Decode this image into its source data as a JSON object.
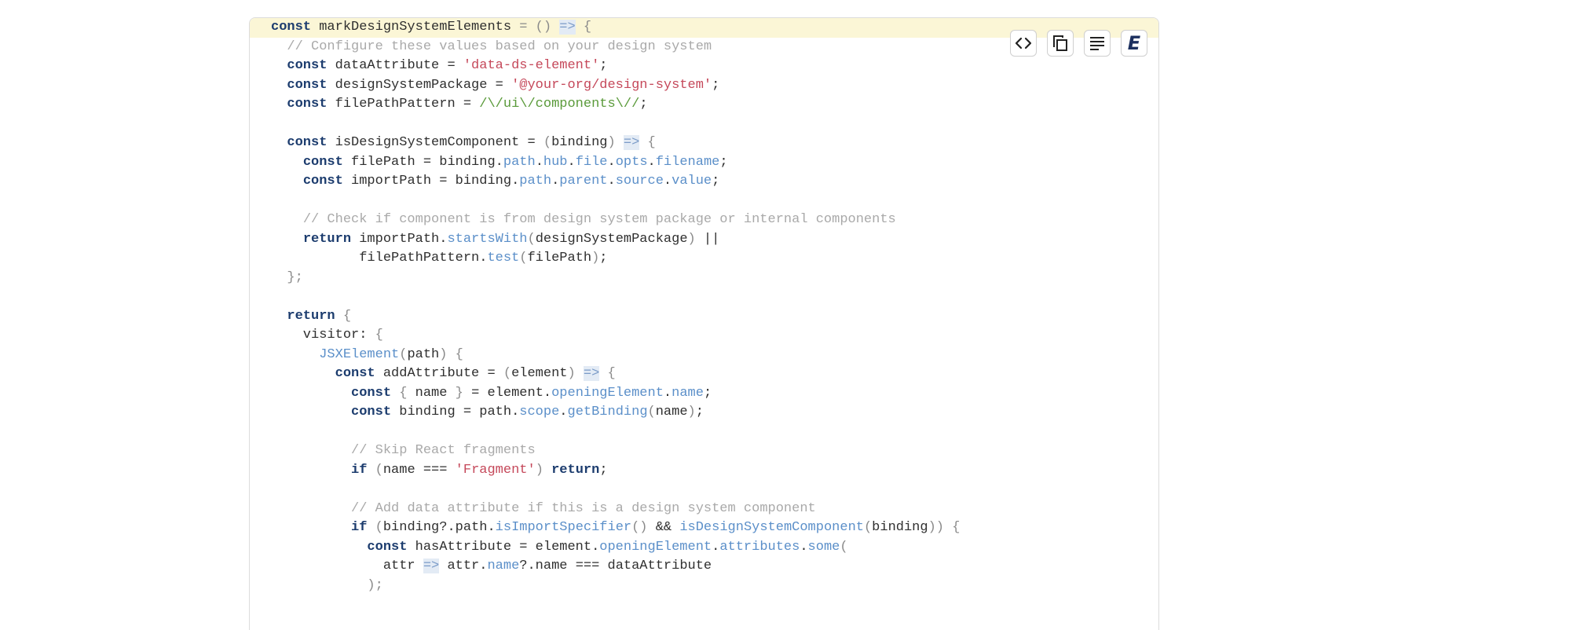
{
  "toolbar": {
    "buttons": [
      {
        "icon": "code-icon"
      },
      {
        "icon": "copy-icon"
      },
      {
        "icon": "wrap-text-icon"
      },
      {
        "icon": "editor-e-icon",
        "glyph": "E"
      }
    ]
  },
  "code": {
    "highlighted_line": 0,
    "lines": [
      [
        [
          "kw",
          "const"
        ],
        [
          "id",
          " markDesignSystemElements "
        ],
        [
          "punc",
          "= ()"
        ],
        [
          "id",
          " "
        ],
        [
          "arrow",
          "=>"
        ],
        [
          "punc",
          " {"
        ]
      ],
      [
        [
          "id",
          "  "
        ],
        [
          "com",
          "// Configure these values based on your design system"
        ]
      ],
      [
        [
          "id",
          "  "
        ],
        [
          "kw",
          "const"
        ],
        [
          "id",
          " dataAttribute = "
        ],
        [
          "str",
          "'data-ds-element'"
        ],
        [
          "id",
          ";"
        ]
      ],
      [
        [
          "id",
          "  "
        ],
        [
          "kw",
          "const"
        ],
        [
          "id",
          " designSystemPackage = "
        ],
        [
          "str",
          "'@your-org/design-system'"
        ],
        [
          "id",
          ";"
        ]
      ],
      [
        [
          "id",
          "  "
        ],
        [
          "kw",
          "const"
        ],
        [
          "id",
          " filePathPattern = "
        ],
        [
          "regex",
          "/\\/ui\\/components\\//"
        ],
        [
          "id",
          ";"
        ]
      ],
      [],
      [
        [
          "id",
          "  "
        ],
        [
          "kw",
          "const"
        ],
        [
          "id",
          " isDesignSystemComponent = "
        ],
        [
          "punc",
          "("
        ],
        [
          "id",
          "binding"
        ],
        [
          "punc",
          ")"
        ],
        [
          "id",
          " "
        ],
        [
          "arrow",
          "=>"
        ],
        [
          "punc",
          " {"
        ]
      ],
      [
        [
          "id",
          "    "
        ],
        [
          "kw",
          "const"
        ],
        [
          "id",
          " filePath = binding."
        ],
        [
          "prop",
          "path"
        ],
        [
          "id",
          "."
        ],
        [
          "prop",
          "hub"
        ],
        [
          "id",
          "."
        ],
        [
          "prop",
          "file"
        ],
        [
          "id",
          "."
        ],
        [
          "prop",
          "opts"
        ],
        [
          "id",
          "."
        ],
        [
          "prop",
          "filename"
        ],
        [
          "id",
          ";"
        ]
      ],
      [
        [
          "id",
          "    "
        ],
        [
          "kw",
          "const"
        ],
        [
          "id",
          " importPath = binding."
        ],
        [
          "prop",
          "path"
        ],
        [
          "id",
          "."
        ],
        [
          "prop",
          "parent"
        ],
        [
          "id",
          "."
        ],
        [
          "prop",
          "source"
        ],
        [
          "id",
          "."
        ],
        [
          "prop",
          "value"
        ],
        [
          "id",
          ";"
        ]
      ],
      [],
      [
        [
          "id",
          "    "
        ],
        [
          "com",
          "// Check if component is from design system package or internal components"
        ]
      ],
      [
        [
          "id",
          "    "
        ],
        [
          "kw",
          "return"
        ],
        [
          "id",
          " importPath."
        ],
        [
          "prop",
          "startsWith"
        ],
        [
          "punc",
          "("
        ],
        [
          "id",
          "designSystemPackage"
        ],
        [
          "punc",
          ")"
        ],
        [
          "id",
          " ||"
        ]
      ],
      [
        [
          "id",
          "           filePathPattern."
        ],
        [
          "prop",
          "test"
        ],
        [
          "punc",
          "("
        ],
        [
          "id",
          "filePath"
        ],
        [
          "punc",
          ")"
        ],
        [
          "id",
          ";"
        ]
      ],
      [
        [
          "id",
          "  "
        ],
        [
          "punc",
          "};"
        ]
      ],
      [],
      [
        [
          "id",
          "  "
        ],
        [
          "kw",
          "return"
        ],
        [
          "punc",
          " {"
        ]
      ],
      [
        [
          "id",
          "    visitor: "
        ],
        [
          "punc",
          "{"
        ]
      ],
      [
        [
          "id",
          "      "
        ],
        [
          "prop",
          "JSXElement"
        ],
        [
          "punc",
          "("
        ],
        [
          "id",
          "path"
        ],
        [
          "punc",
          ")"
        ],
        [
          "punc",
          " {"
        ]
      ],
      [
        [
          "id",
          "        "
        ],
        [
          "kw",
          "const"
        ],
        [
          "id",
          " addAttribute = "
        ],
        [
          "punc",
          "("
        ],
        [
          "id",
          "element"
        ],
        [
          "punc",
          ")"
        ],
        [
          "id",
          " "
        ],
        [
          "arrow",
          "=>"
        ],
        [
          "punc",
          " {"
        ]
      ],
      [
        [
          "id",
          "          "
        ],
        [
          "kw",
          "const"
        ],
        [
          "punc",
          " {"
        ],
        [
          "id",
          " name "
        ],
        [
          "punc",
          "}"
        ],
        [
          "id",
          " = element."
        ],
        [
          "prop",
          "openingElement"
        ],
        [
          "id",
          "."
        ],
        [
          "prop",
          "name"
        ],
        [
          "id",
          ";"
        ]
      ],
      [
        [
          "id",
          "          "
        ],
        [
          "kw",
          "const"
        ],
        [
          "id",
          " binding = path."
        ],
        [
          "prop",
          "scope"
        ],
        [
          "id",
          "."
        ],
        [
          "prop",
          "getBinding"
        ],
        [
          "punc",
          "("
        ],
        [
          "id",
          "name"
        ],
        [
          "punc",
          ")"
        ],
        [
          "id",
          ";"
        ]
      ],
      [],
      [
        [
          "id",
          "          "
        ],
        [
          "com",
          "// Skip React fragments"
        ]
      ],
      [
        [
          "id",
          "          "
        ],
        [
          "kw",
          "if"
        ],
        [
          "punc",
          " ("
        ],
        [
          "id",
          "name === "
        ],
        [
          "str",
          "'Fragment'"
        ],
        [
          "punc",
          ")"
        ],
        [
          "id",
          " "
        ],
        [
          "kw",
          "return"
        ],
        [
          "id",
          ";"
        ]
      ],
      [],
      [
        [
          "id",
          "          "
        ],
        [
          "com",
          "// Add data attribute if this is a design system component"
        ]
      ],
      [
        [
          "id",
          "          "
        ],
        [
          "kw",
          "if"
        ],
        [
          "punc",
          " ("
        ],
        [
          "id",
          "binding?.path."
        ],
        [
          "prop",
          "isImportSpecifier"
        ],
        [
          "punc",
          "()"
        ],
        [
          "id",
          " && "
        ],
        [
          "prop",
          "isDesignSystemComponent"
        ],
        [
          "punc",
          "("
        ],
        [
          "id",
          "binding"
        ],
        [
          "punc",
          "))"
        ],
        [
          "punc",
          " {"
        ]
      ],
      [
        [
          "id",
          "            "
        ],
        [
          "kw",
          "const"
        ],
        [
          "id",
          " hasAttribute = element."
        ],
        [
          "prop",
          "openingElement"
        ],
        [
          "id",
          "."
        ],
        [
          "prop",
          "attributes"
        ],
        [
          "id",
          "."
        ],
        [
          "prop",
          "some"
        ],
        [
          "punc",
          "("
        ]
      ],
      [
        [
          "id",
          "              attr "
        ],
        [
          "arrow",
          "=>"
        ],
        [
          "id",
          " attr."
        ],
        [
          "prop",
          "name"
        ],
        [
          "id",
          "?.name === dataAttribute"
        ]
      ],
      [
        [
          "id",
          "            "
        ],
        [
          "punc",
          ");"
        ]
      ]
    ]
  }
}
